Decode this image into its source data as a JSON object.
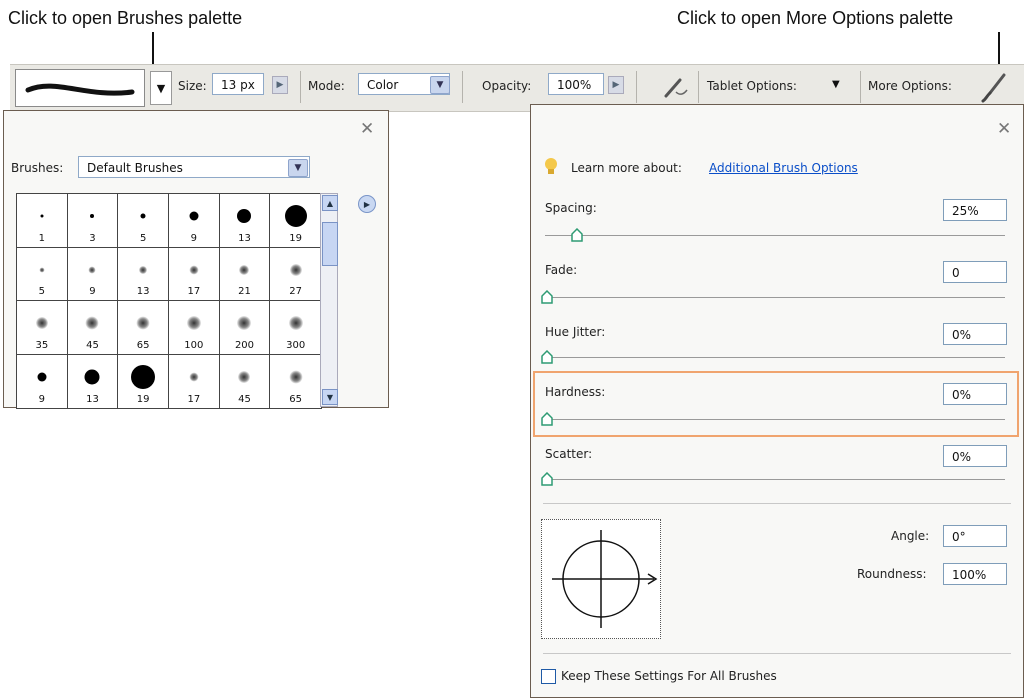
{
  "callouts": {
    "left": "Click to open Brushes palette",
    "right": "Click to open More Options palette"
  },
  "toolbar": {
    "size_label": "Size:",
    "size_value": "13 px",
    "mode_label": "Mode:",
    "mode_value": "Color",
    "opacity_label": "Opacity:",
    "opacity_value": "100%",
    "tablet_label": "Tablet Options:",
    "more_label": "More Options:"
  },
  "brushes_panel": {
    "brushes_label": "Brushes:",
    "brushes_value": "Default Brushes",
    "presets": [
      {
        "size": "1",
        "kind": "hard",
        "level": 0.05
      },
      {
        "size": "3",
        "kind": "hard",
        "level": 0.08
      },
      {
        "size": "5",
        "kind": "hard",
        "level": 0.12
      },
      {
        "size": "9",
        "kind": "hard",
        "level": 0.3
      },
      {
        "size": "13",
        "kind": "hard",
        "level": 0.5
      },
      {
        "size": "19",
        "kind": "hard",
        "level": 0.85
      },
      {
        "size": "5",
        "kind": "soft",
        "level": 0.12
      },
      {
        "size": "9",
        "kind": "soft",
        "level": 0.2
      },
      {
        "size": "13",
        "kind": "soft",
        "level": 0.25
      },
      {
        "size": "17",
        "kind": "soft",
        "level": 0.3
      },
      {
        "size": "21",
        "kind": "soft",
        "level": 0.35
      },
      {
        "size": "27",
        "kind": "soft",
        "level": 0.4
      },
      {
        "size": "35",
        "kind": "soft",
        "level": 0.42
      },
      {
        "size": "45",
        "kind": "soft",
        "level": 0.44
      },
      {
        "size": "65",
        "kind": "soft",
        "level": 0.46
      },
      {
        "size": "100",
        "kind": "soft",
        "level": 0.48
      },
      {
        "size": "200",
        "kind": "soft",
        "level": 0.5
      },
      {
        "size": "300",
        "kind": "soft",
        "level": 0.52
      },
      {
        "size": "9",
        "kind": "hard",
        "level": 0.3
      },
      {
        "size": "13",
        "kind": "hard",
        "level": 0.55
      },
      {
        "size": "19",
        "kind": "hard",
        "level": 0.9
      },
      {
        "size": "17",
        "kind": "soft",
        "level": 0.3
      },
      {
        "size": "45",
        "kind": "soft",
        "level": 0.4
      },
      {
        "size": "65",
        "kind": "soft",
        "level": 0.45
      }
    ]
  },
  "options_panel": {
    "learn_prefix": "Learn more about:",
    "learn_link": "Additional Brush Options",
    "spacing_label": "Spacing:",
    "spacing_value": "25%",
    "spacing_level": 0.25,
    "fade_label": "Fade:",
    "fade_value": "0",
    "fade_level": 0,
    "hue_label": "Hue Jitter:",
    "hue_value": "0%",
    "hue_level": 0,
    "hardness_label": "Hardness:",
    "hardness_value": "0%",
    "hardness_level": 0,
    "scatter_label": "Scatter:",
    "scatter_value": "0%",
    "scatter_level": 0,
    "angle_label": "Angle:",
    "angle_value": "0°",
    "roundness_label": "Roundness:",
    "roundness_value": "100%",
    "keep_label": "Keep These Settings For All Brushes"
  },
  "colors": {
    "highlight": "#f0a46e",
    "thumb": "#2e9b73",
    "link": "#0a4ec8"
  }
}
